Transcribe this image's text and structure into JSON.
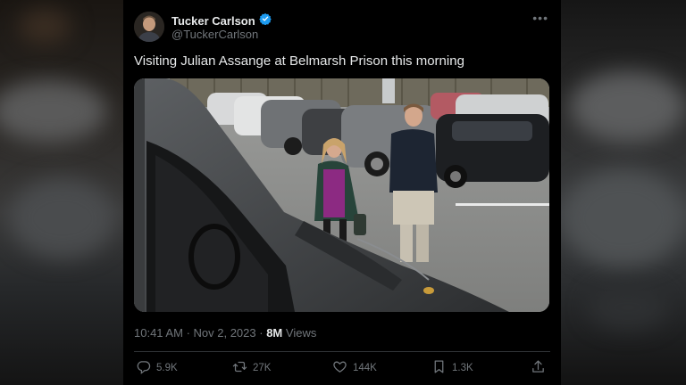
{
  "author": {
    "name": "Tucker Carlson",
    "handle": "@TuckerCarlson",
    "verified": true
  },
  "tweet": {
    "text": "Visiting Julian Assange at Belmarsh Prison this morning"
  },
  "meta": {
    "time": "10:41 AM",
    "date": "Nov 2, 2023",
    "views_count": "8M",
    "views_label": "Views"
  },
  "actions": {
    "replies": "5.9K",
    "reposts": "27K",
    "likes": "144K",
    "bookmarks": "1.3K"
  },
  "icons": {
    "verified": "verified-badge-icon",
    "more": "more-horizontal-icon",
    "reply": "reply-icon",
    "repost": "repost-icon",
    "like": "heart-icon",
    "bookmark": "bookmark-icon",
    "share": "share-icon"
  },
  "colors": {
    "background": "#000000",
    "text": "#e7e9ea",
    "secondary_text": "#71767b",
    "verified": "#1d9bf0",
    "divider": "#2f3336"
  }
}
